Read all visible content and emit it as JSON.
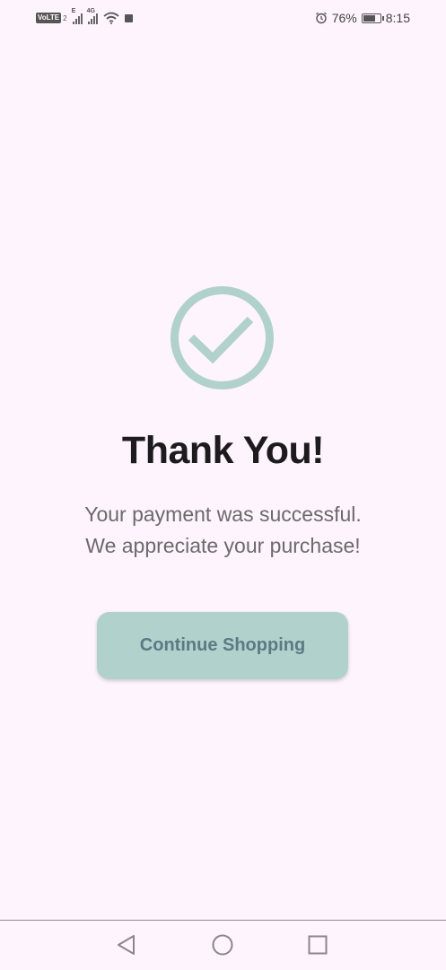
{
  "status_bar": {
    "volte_label": "VoLTE",
    "sim_number": "2",
    "signal1_tag": "E",
    "signal2_tag": "4G",
    "battery_percent": "76%",
    "battery_level": 0.76,
    "time": "8:15"
  },
  "main": {
    "title": "Thank You!",
    "message_line1": "Your payment was successful.",
    "message_line2": "We appreciate your purchase!",
    "cta_label": "Continue Shopping"
  },
  "colors": {
    "background": "#fdf4fd",
    "accent": "#b0d1cc",
    "title": "#1e1b1e",
    "button_text": "#5a7a84"
  },
  "icons": {
    "check": "check-circle-icon",
    "back": "back-triangle-icon",
    "home": "home-circle-icon",
    "recent": "recent-apps-square-icon"
  }
}
